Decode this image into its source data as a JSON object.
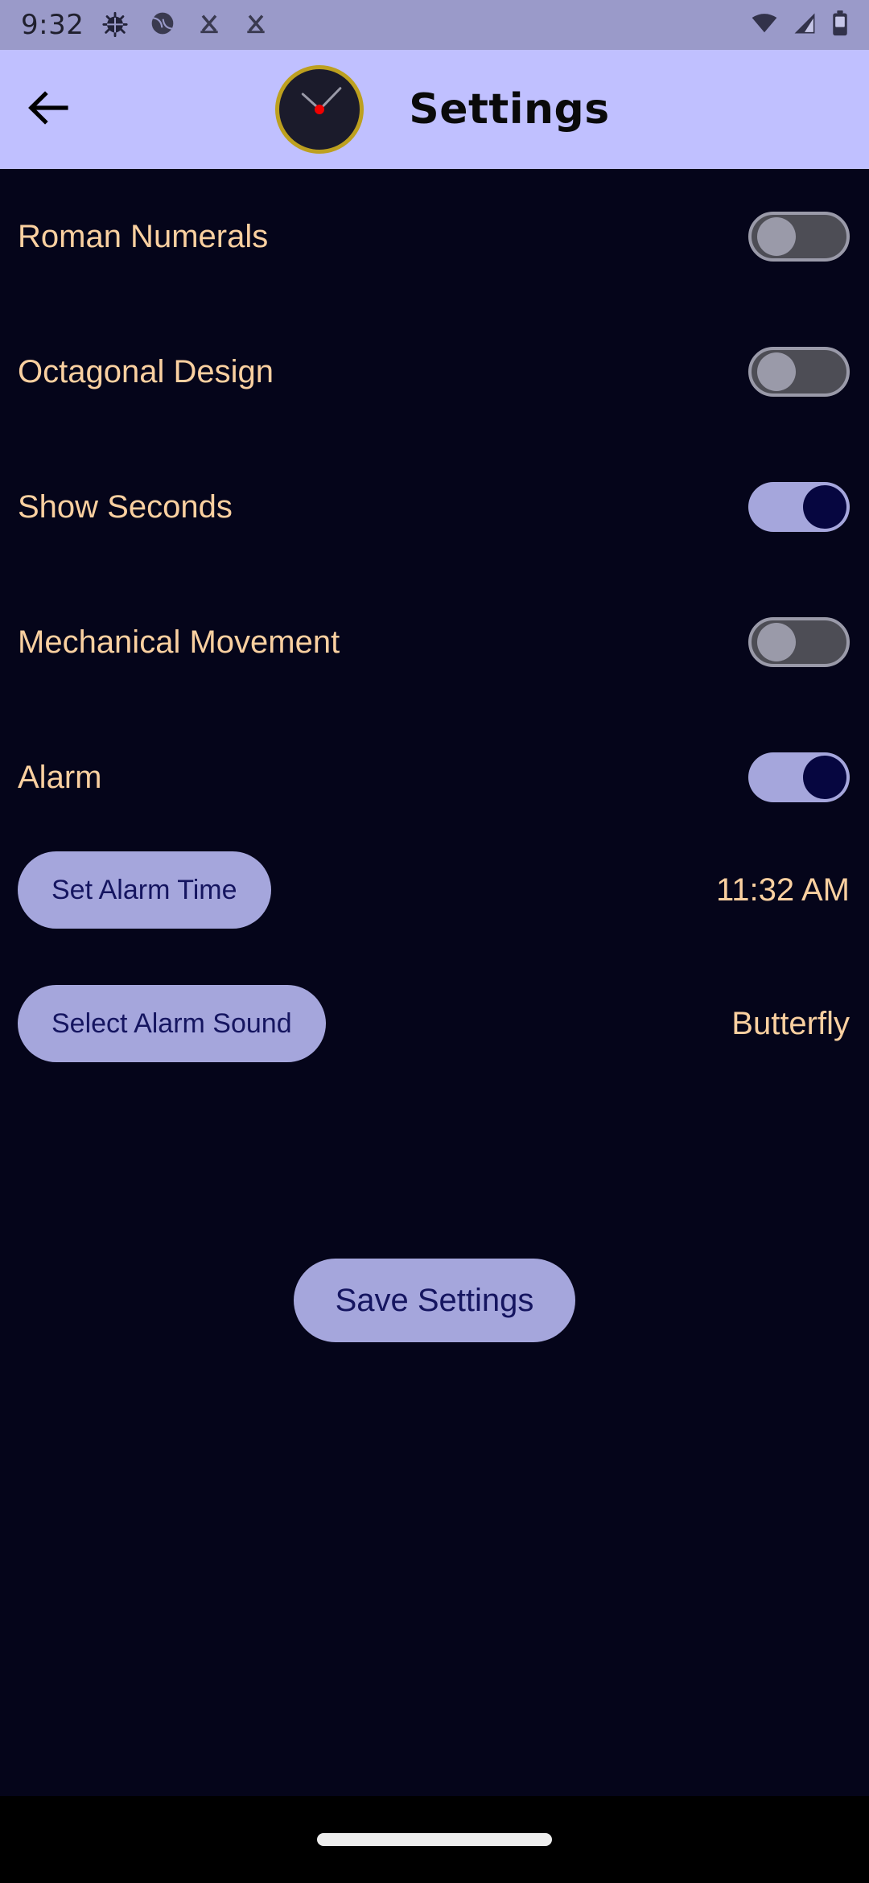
{
  "status_bar": {
    "clock": "9:32",
    "left_icons": [
      "bug-icon",
      "ball-icon",
      "x-mark-icon",
      "x-mark-icon"
    ],
    "right_icons": [
      "wifi-icon",
      "cellular-signal-icon",
      "battery-icon"
    ],
    "background_color": "#9a9ac9"
  },
  "app_bar": {
    "back_label": "back-arrow-icon",
    "title": "Settings",
    "background_color": "#c0c0ff",
    "clock_icon": {
      "bezel_color": "#bda01f",
      "face_color": "#1b1b2b",
      "hand_color": "#9a9aa8",
      "center_color": "#f00000"
    }
  },
  "theme": {
    "background": "#05051a",
    "label_color": "#fad0a0",
    "accent": "#a5a6dc",
    "button_text": "#151560",
    "toggle_off_track": "#4d4d55",
    "toggle_off_thumb": "#9a9aa9",
    "toggle_on_track": "#a5a6dc",
    "toggle_on_thumb": "#060640"
  },
  "settings": {
    "toggles": [
      {
        "label": "Roman Numerals",
        "state": "off"
      },
      {
        "label": "Octagonal Design",
        "state": "off"
      },
      {
        "label": "Show Seconds",
        "state": "on"
      },
      {
        "label": "Mechanical Movement",
        "state": "off"
      },
      {
        "label": "Alarm",
        "state": "on"
      }
    ],
    "actions": [
      {
        "button": "Set Alarm Time",
        "value": "11:32 AM"
      },
      {
        "button": "Select Alarm Sound",
        "value": "Butterfly"
      }
    ],
    "save_label": "Save Settings"
  },
  "nav_bar": {
    "gesture_pill": "home-gesture-pill",
    "background_color": "#000000"
  }
}
